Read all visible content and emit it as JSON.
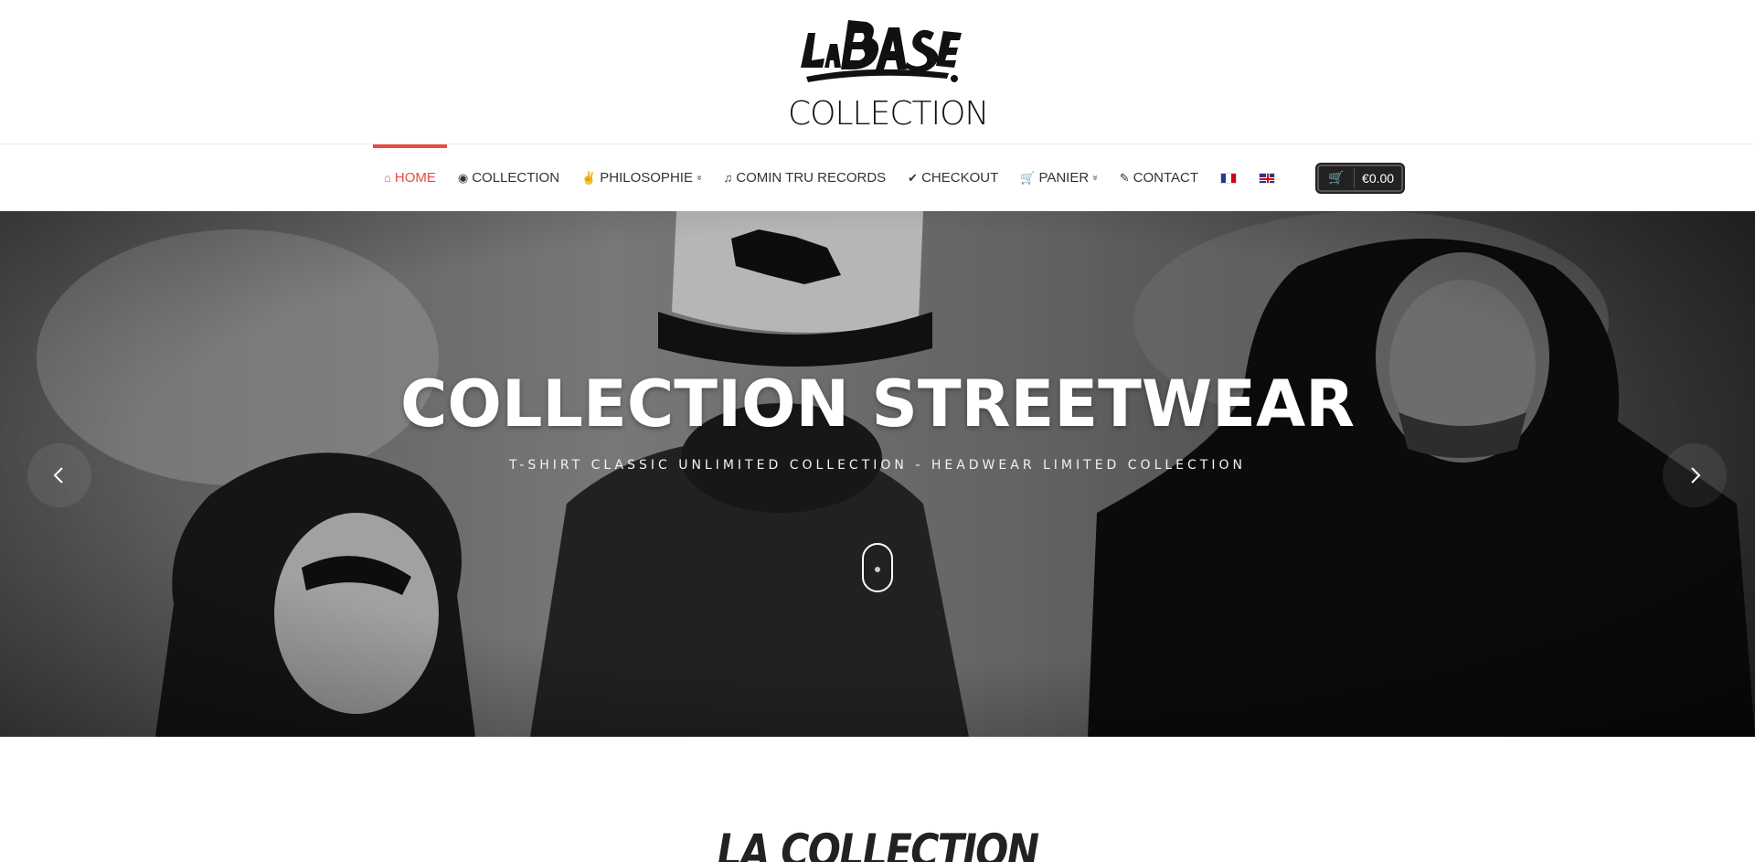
{
  "logo": {
    "tag_text": "LaBASE",
    "subtitle": "COLLECTION"
  },
  "nav": {
    "items": [
      {
        "label": "HOME",
        "icon": "home-icon",
        "glyph": "⌂",
        "has_caret": false,
        "active": true
      },
      {
        "label": "COLLECTION",
        "icon": "eye-icon",
        "glyph": "◉",
        "has_caret": false,
        "active": false
      },
      {
        "label": "PHILOSOPHIE",
        "icon": "peace-hand-icon",
        "glyph": "✌",
        "has_caret": true,
        "active": false
      },
      {
        "label": "COMIN TRU RECORDS",
        "icon": "music-icon",
        "glyph": "♫",
        "has_caret": false,
        "active": false
      },
      {
        "label": "CHECKOUT",
        "icon": "check-icon",
        "glyph": "✔",
        "has_caret": false,
        "active": false
      },
      {
        "label": "PANIER",
        "icon": "cart-icon",
        "glyph": "🛒",
        "has_caret": true,
        "active": false
      },
      {
        "label": "CONTACT",
        "icon": "pencil-icon",
        "glyph": "✎",
        "has_caret": false,
        "active": false
      }
    ],
    "caret_glyph": "»",
    "languages": [
      {
        "code": "fr",
        "icon": "flag-fr-icon"
      },
      {
        "code": "en",
        "icon": "flag-uk-icon"
      }
    ],
    "cart": {
      "amount": "€0.00",
      "icon": "shopping-cart-icon",
      "glyph": "🛒"
    }
  },
  "hero": {
    "title": "COLLECTION STREETWEAR",
    "subtitle": "T-SHIRT CLASSIC UNLIMITED COLLECTION - HEADWEAR LIMITED COLLECTION",
    "prev_icon": "chevron-left-icon",
    "next_icon": "chevron-right-icon",
    "scroll_icon": "mouse-scroll-icon"
  },
  "section": {
    "title": "LA COLLECTION"
  },
  "colors": {
    "accent": "#e74c3c",
    "text": "#333333",
    "cart_bg": "#222222"
  }
}
